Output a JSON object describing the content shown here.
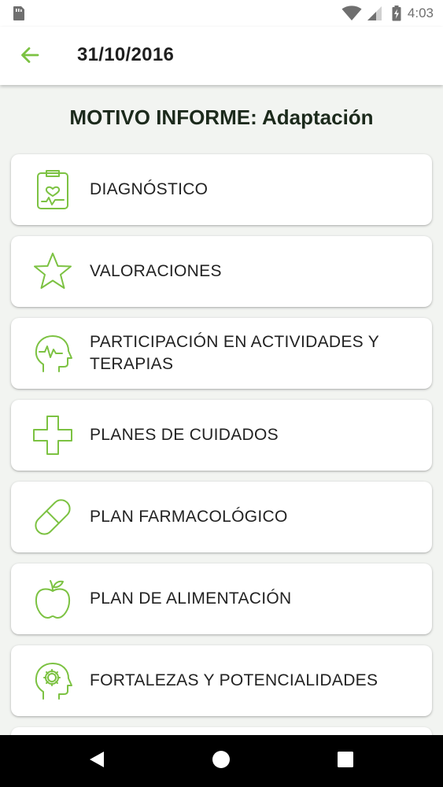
{
  "status_bar": {
    "time": "4:03",
    "icons": [
      "sim-card-icon",
      "wifi-icon",
      "signal-icon",
      "battery-charging-icon"
    ]
  },
  "app_bar": {
    "back_icon": "arrow-left-icon",
    "title": "31/10/2016"
  },
  "report": {
    "heading": "MOTIVO INFORME: Adaptación"
  },
  "menu": {
    "items": [
      {
        "label": "DIAGNÓSTICO",
        "icon": "clipboard-heart-icon"
      },
      {
        "label": "VALORACIONES",
        "icon": "star-icon"
      },
      {
        "label": "PARTICIPACIÓN EN ACTIVIDADES Y TERAPIAS",
        "icon": "head-pulse-icon"
      },
      {
        "label": "PLANES DE CUIDADOS",
        "icon": "medical-cross-icon"
      },
      {
        "label": "PLAN FARMACOLÓGICO",
        "icon": "pill-icon"
      },
      {
        "label": "PLAN DE ALIMENTACIÓN",
        "icon": "apple-icon"
      },
      {
        "label": "FORTALEZAS Y POTENCIALIDADES",
        "icon": "head-gear-icon"
      }
    ]
  },
  "nav_bar": {
    "buttons": [
      "back-triangle-icon",
      "home-circle-icon",
      "recents-square-icon"
    ]
  },
  "colors": {
    "accent_green": "#7cc242",
    "background": "#f2f4f1",
    "card": "#ffffff",
    "nav_bar": "#000000"
  }
}
